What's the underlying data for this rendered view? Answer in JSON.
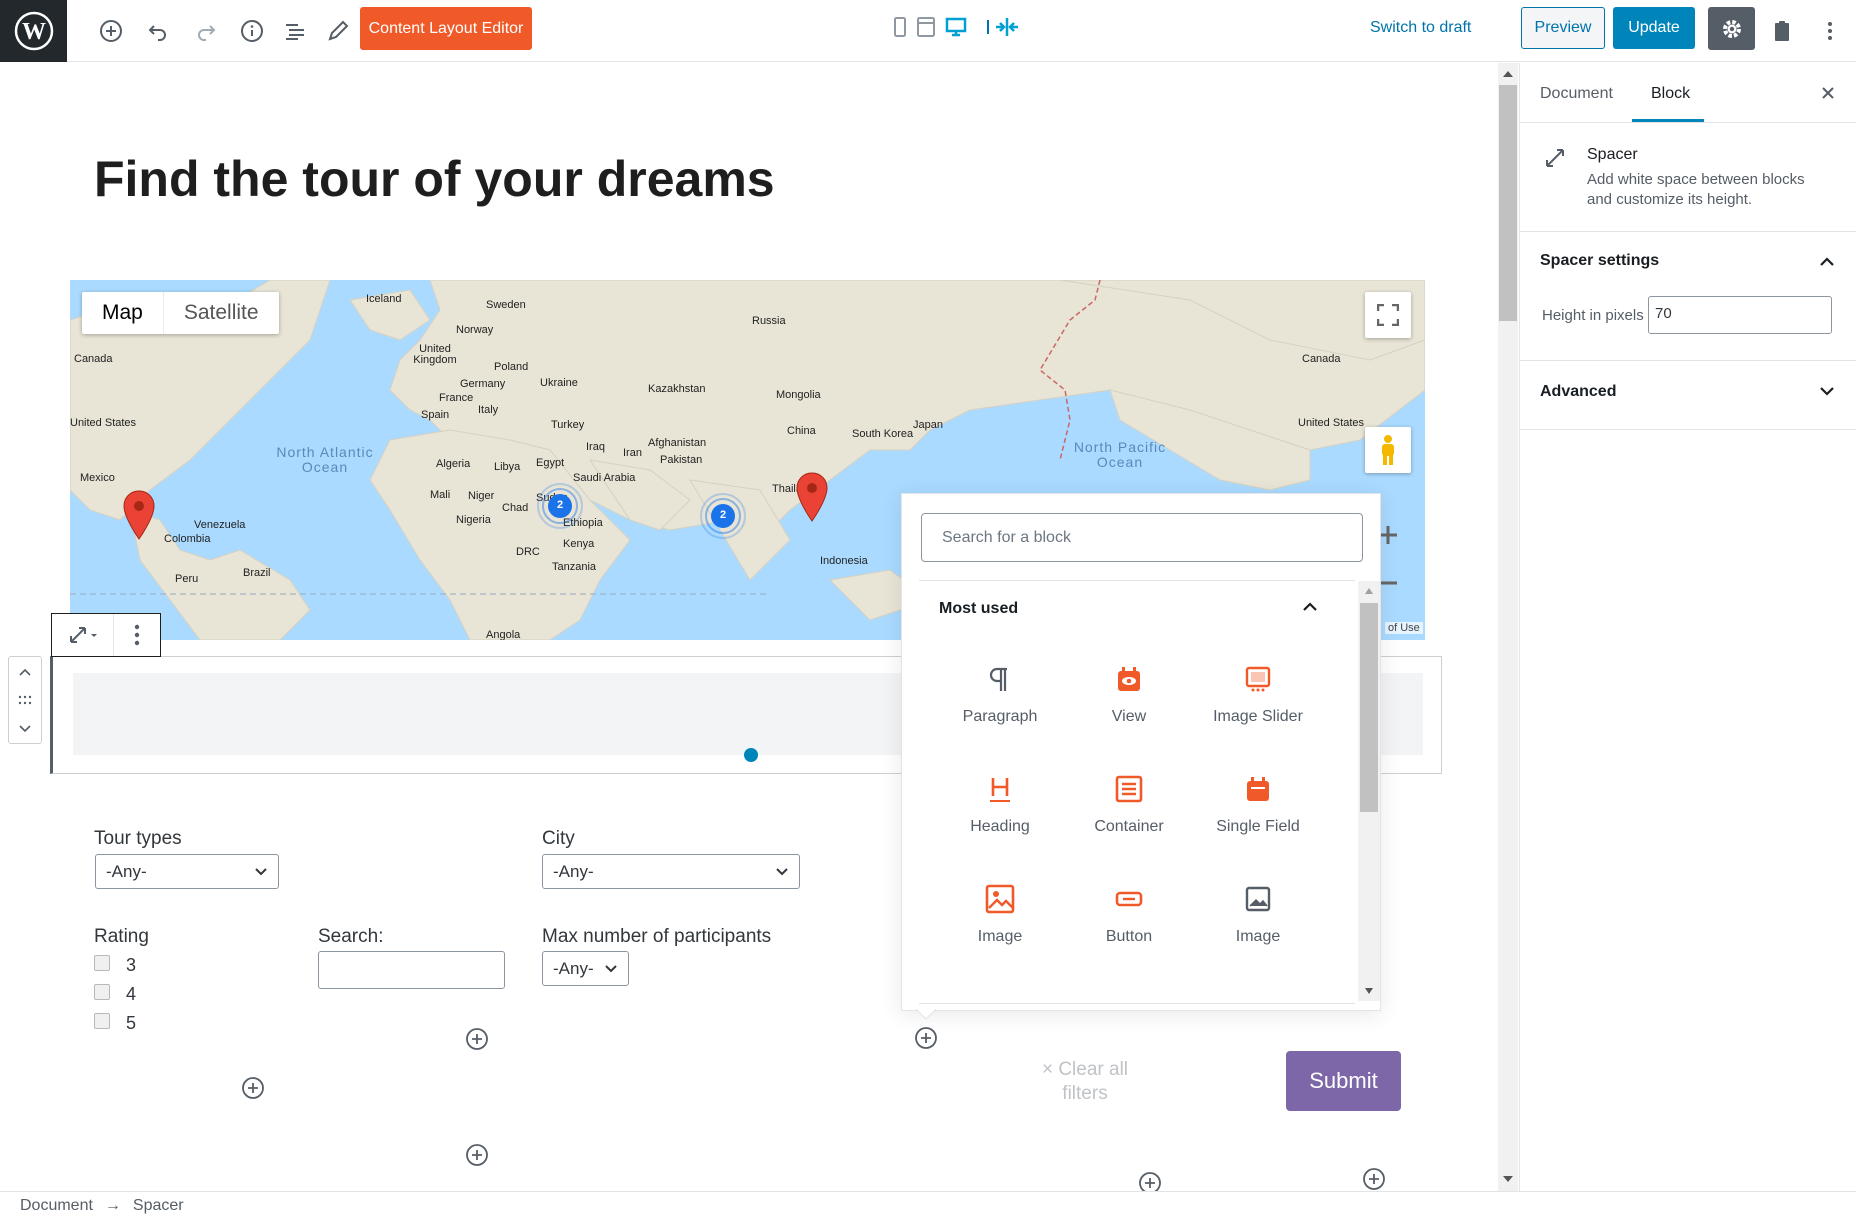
{
  "toolbar": {
    "content_layout_editor": "Content Layout Editor",
    "switch_to_draft": "Switch to draft",
    "preview": "Preview",
    "update": "Update",
    "accent_color": "#f05a28"
  },
  "page": {
    "title": "Find the tour of your dreams"
  },
  "map": {
    "type_map": "Map",
    "type_satellite": "Satellite",
    "terms": "of Use",
    "oceans": [
      "North Atlantic Ocean",
      "North Pacific Ocean"
    ],
    "labels": [
      "Iceland",
      "Sweden",
      "Norway",
      "Russia",
      "United Kingdom",
      "Poland",
      "Germany",
      "Ukraine",
      "France",
      "Kazakhstan",
      "Mongolia",
      "Spain",
      "Italy",
      "Turkey",
      "China",
      "South Korea",
      "Japan",
      "Canada",
      "Canada",
      "United States",
      "United States",
      "Mexico",
      "Algeria",
      "Libya",
      "Egypt",
      "Iraq",
      "Iran",
      "Afghanistan",
      "Pakistan",
      "Saudi Arabia",
      "Thailand",
      "Mali",
      "Niger",
      "Chad",
      "Sudan",
      "Nigeria",
      "Ethiopia",
      "Kenya",
      "DRC",
      "Tanzania",
      "Venezuela",
      "Colombia",
      "Brazil",
      "Peru",
      "Indonesia",
      "Angola"
    ],
    "cluster_counts": [
      "2",
      "2"
    ]
  },
  "filters": {
    "tour_types_label": "Tour types",
    "tour_types_value": "-Any-",
    "city_label": "City",
    "city_value": "-Any-",
    "rating_label": "Rating",
    "ratings": [
      "3",
      "4",
      "5"
    ],
    "search_label": "Search:",
    "search_value": "",
    "max_participants_label": "Max number of participants",
    "max_participants_value": "-Any-",
    "clear_filters": "× Clear all filters",
    "submit": "Submit"
  },
  "inserter": {
    "search_placeholder": "Search for a block",
    "section_title": "Most used",
    "blocks": [
      {
        "label": "Paragraph",
        "icon": "paragraph-icon"
      },
      {
        "label": "View",
        "icon": "view-icon"
      },
      {
        "label": "Image Slider",
        "icon": "image-slider-icon"
      },
      {
        "label": "Heading",
        "icon": "heading-icon"
      },
      {
        "label": "Container",
        "icon": "container-icon"
      },
      {
        "label": "Single Field",
        "icon": "single-field-icon"
      },
      {
        "label": "Image",
        "icon": "image-icon"
      },
      {
        "label": "Button",
        "icon": "button-icon"
      },
      {
        "label": "Image",
        "icon": "image-icon"
      }
    ]
  },
  "sidebar": {
    "tab_document": "Document",
    "tab_block": "Block",
    "block_name": "Spacer",
    "block_description": "Add white space between blocks and customize its height.",
    "spacer_settings": "Spacer settings",
    "height_label": "Height in pixels",
    "height_value": "70",
    "advanced": "Advanced"
  },
  "breadcrumb": {
    "root": "Document",
    "separator": "→",
    "current": "Spacer"
  }
}
